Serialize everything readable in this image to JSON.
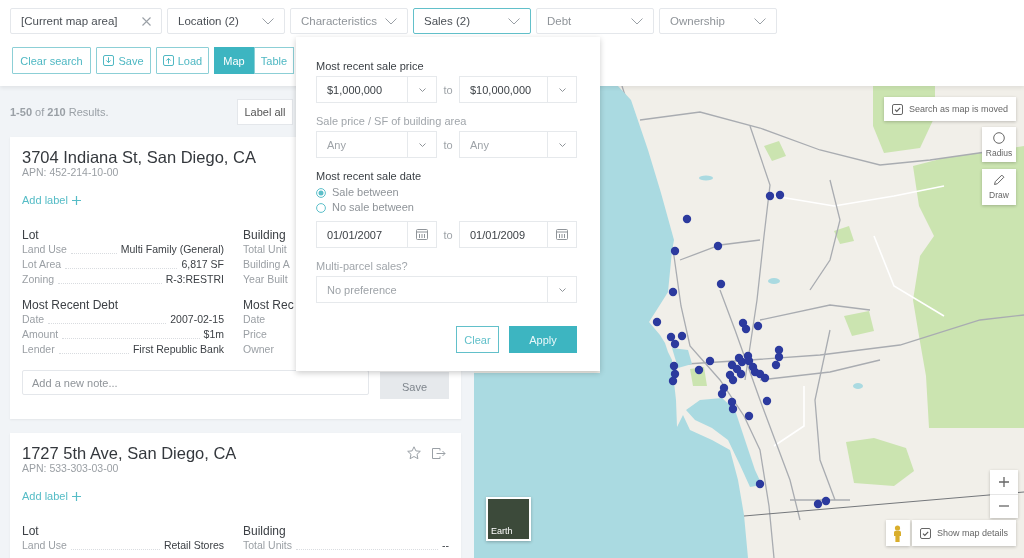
{
  "filters": [
    {
      "label": "[Current map area]",
      "kind": "clearable",
      "active": true,
      "selected": false
    },
    {
      "label": "Location (2)",
      "kind": "dropdown",
      "active": true,
      "selected": false
    },
    {
      "label": "Characteristics",
      "kind": "dropdown",
      "active": false,
      "selected": false
    },
    {
      "label": "Sales (2)",
      "kind": "dropdown",
      "active": true,
      "selected": true
    },
    {
      "label": "Debt",
      "kind": "dropdown",
      "active": false,
      "selected": false
    },
    {
      "label": "Ownership",
      "kind": "dropdown",
      "active": false,
      "selected": false
    }
  ],
  "actions": [
    {
      "label": "Clear search",
      "kind": "clear"
    },
    {
      "label": "Save",
      "kind": "save"
    },
    {
      "label": "Load",
      "kind": "load"
    }
  ],
  "views": [
    {
      "label": "Map",
      "selected": true
    },
    {
      "label": "Table",
      "selected": false
    }
  ],
  "results": {
    "summary": "**1-50** of **210** Results.",
    "label_all": "Label all"
  },
  "cards": [
    {
      "title": "3704 Indiana St, San Diego, CA",
      "apn": "APN: 452-214-10-00",
      "add_label": "Add label",
      "columns": [
        [
          {
            "heading": "Lot",
            "rows": [
              {
                "label": "Land Use",
                "value": "Multi Family (General)"
              },
              {
                "label": "Lot Area",
                "value": "6,817 SF"
              },
              {
                "label": "Zoning",
                "value": "R-3:RESTRI"
              }
            ]
          },
          {
            "heading": "Most Recent Debt",
            "rows": [
              {
                "label": "Date",
                "value": "2007-02-15"
              },
              {
                "label": "Amount",
                "value": "$1m"
              },
              {
                "label": "Lender",
                "value": "First Republic Bank"
              }
            ]
          }
        ],
        [
          {
            "heading": "Building",
            "rows": [
              {
                "label": "Total Unit"
              },
              {
                "label": "Building A"
              },
              {
                "label": "Year Built"
              }
            ]
          },
          {
            "heading": "Most Rec",
            "rows": [
              {
                "label": "Date"
              },
              {
                "label": "Price"
              },
              {
                "label": "Owner"
              }
            ]
          }
        ]
      ],
      "note": {
        "placeholder": "Add a new note...",
        "save": {
          "label": "Save",
          "disabled": true
        }
      }
    },
    {
      "title": "1727 5th Ave, San Diego, CA",
      "apn": "APN: 533-303-03-00",
      "starred": false,
      "add_label": "Add label",
      "columns": [
        [
          {
            "heading": "Lot",
            "rows": [
              {
                "label": "Land Use",
                "value": "Retail Stores"
              }
            ]
          }
        ],
        [
          {
            "heading": "Building",
            "rows": [
              {
                "label": "Total Units",
                "value": "--"
              }
            ]
          }
        ]
      ]
    }
  ],
  "sales_panel": {
    "sections": [
      {
        "kind": "range_select",
        "label": "Most recent sale price",
        "active": true,
        "from": {
          "value": "$1,000,000"
        },
        "joiner": "to",
        "to": {
          "value": "$10,000,000"
        }
      },
      {
        "kind": "range_select",
        "label": "Sale price / SF of building area",
        "active": false,
        "from": {
          "placeholder": "Any"
        },
        "joiner": "to",
        "to": {
          "placeholder": "Any"
        }
      },
      {
        "kind": "date_range",
        "label": "Most recent sale date",
        "active": true,
        "options": [
          {
            "label": "Sale between",
            "selected": true
          },
          {
            "label": "No sale between",
            "selected": false
          }
        ],
        "from": "01/01/2007",
        "joiner": "to",
        "to": "01/01/2009"
      },
      {
        "kind": "select",
        "label": "Multi-parcel sales?",
        "active": false,
        "field": {
          "placeholder": "No preference"
        }
      }
    ],
    "buttons": [
      {
        "label": "Clear",
        "kind": "secondary"
      },
      {
        "label": "Apply",
        "kind": "primary"
      }
    ]
  },
  "map": {
    "search_toggle": {
      "label": "Search as map is moved",
      "checked": true
    },
    "tools": [
      {
        "label": "Radius",
        "kind": "radius"
      },
      {
        "label": "Draw",
        "kind": "draw"
      }
    ],
    "earth_button": {
      "label": "Earth"
    },
    "details_toggle": {
      "label": "Show map details",
      "checked": true
    }
  }
}
